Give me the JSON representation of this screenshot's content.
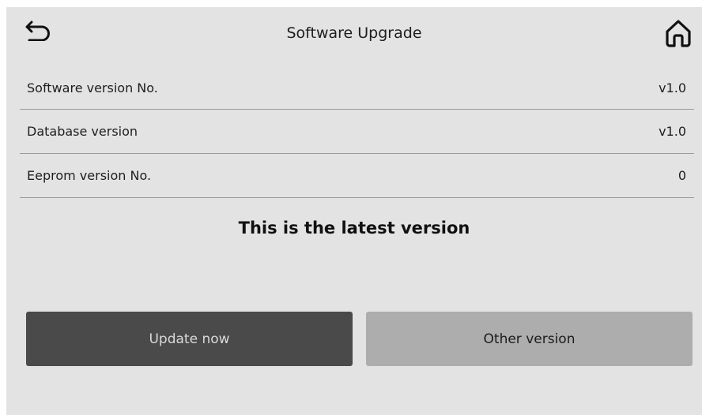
{
  "header": {
    "title": "Software Upgrade",
    "back_icon": "back-arrow-icon",
    "home_icon": "home-icon"
  },
  "info_rows": [
    {
      "label": "Software version No.",
      "value": "v1.0"
    },
    {
      "label": "Database version",
      "value": "v1.0"
    },
    {
      "label": "Eeprom version No.",
      "value": "0"
    }
  ],
  "status_message": "This is the latest version",
  "buttons": {
    "update_label": "Update now",
    "other_label": "Other version"
  },
  "colors": {
    "background": "#e3e3e3",
    "primary_button": "#4a4a4a",
    "secondary_button": "#adadad",
    "divider": "#9a9a9a"
  }
}
